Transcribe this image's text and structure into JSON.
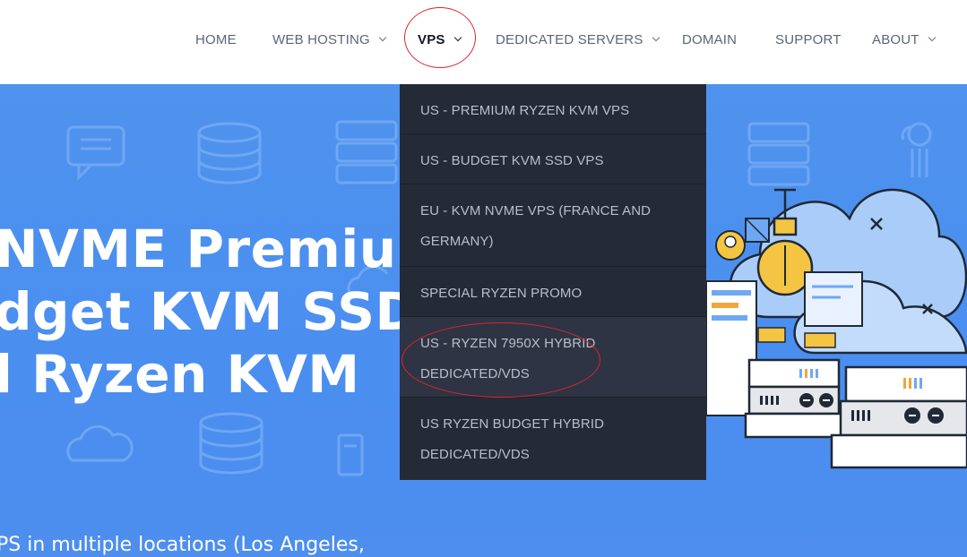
{
  "nav": {
    "items": [
      {
        "label": "HOME",
        "has_dropdown": false
      },
      {
        "label": "WEB HOSTING",
        "has_dropdown": true
      },
      {
        "label": "VPS",
        "has_dropdown": true,
        "active": true
      },
      {
        "label": "DEDICATED SERVERS",
        "has_dropdown": true
      },
      {
        "label": "DOMAIN",
        "has_dropdown": false
      },
      {
        "label": "SUPPORT",
        "has_dropdown": false
      },
      {
        "label": "ABOUT",
        "has_dropdown": true
      }
    ]
  },
  "dropdown": {
    "items": [
      {
        "line1": "US - PREMIUM RYZEN KVM VPS",
        "line2": ""
      },
      {
        "line1": "US - BUDGET KVM SSD VPS",
        "line2": ""
      },
      {
        "line1": "EU - KVM NVME VPS (FRANCE AND",
        "line2": "GERMANY)"
      },
      {
        "line1": "SPECIAL RYZEN PROMO",
        "line2": ""
      },
      {
        "line1": "US - RYZEN 7950X HYBRID",
        "line2": "DEDICATED/VDS"
      },
      {
        "line1": "US RYZEN BUDGET HYBRID",
        "line2": "DEDICATED/VDS"
      }
    ]
  },
  "hero": {
    "title_lines": [
      "NVME Premium",
      "dget KVM SSD",
      "l Ryzen KVM"
    ],
    "subtitle": "PS in multiple locations (Los Angeles,"
  },
  "colors": {
    "hero_bg": "#4a8ef0",
    "dropdown_bg": "#252a37",
    "annotation_red": "#d9262c"
  },
  "icons": [
    "chat-icon",
    "database-icon",
    "server-icon",
    "cloud-icon",
    "mobile-icon",
    "cloud-tree-icon"
  ]
}
